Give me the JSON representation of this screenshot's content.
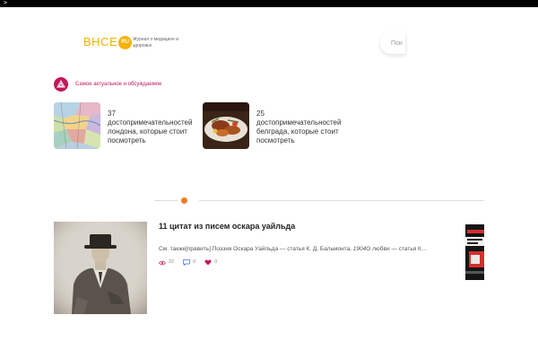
{
  "browser": {
    "glyph": ">"
  },
  "site": {
    "logo_text": "ВНСЕ",
    "logo_badge": "RU",
    "tagline": "Журнал о медицине и здоровье"
  },
  "search": {
    "placeholder": "Пои"
  },
  "featured": {
    "label": "Самое актуальное и обсуждаемое",
    "items": [
      {
        "text": "37 достопримечательностей лондона, которые стоит посмотреть"
      },
      {
        "text": "25 достопримечательностей белграда, которые стоит посмотреть"
      }
    ]
  },
  "article": {
    "title": "11 цитат из писем оскара уайльда",
    "excerpt_start": "См. также[править] Поэзия Оскара Уайльда — статья К. Д. Бальмонта, ",
    "excerpt_italic": "1904",
    "excerpt_end": "О любви — статья К…",
    "views": "22",
    "comments": "0",
    "likes": "0"
  },
  "colors": {
    "brand_yellow": "#f6b100",
    "accent_pink": "#c2185b",
    "accent_orange": "#f47b20"
  }
}
